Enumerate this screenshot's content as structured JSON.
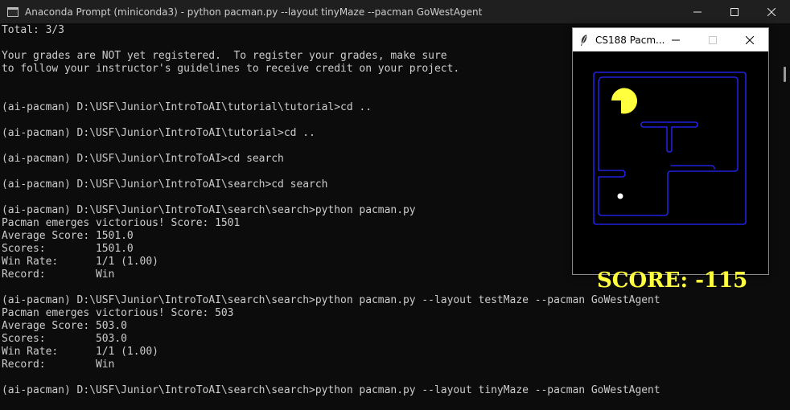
{
  "window": {
    "title": "Anaconda Prompt (miniconda3) - python  pacman.py --layout tinyMaze --pacman GoWestAgent",
    "icon": "terminal-icon",
    "controls": [
      "minimize-icon",
      "maximize-icon",
      "close-icon"
    ]
  },
  "terminal": {
    "lines": [
      "Total: 3/3",
      "",
      "Your grades are NOT yet registered.  To register your grades, make sure",
      "to follow your instructor's guidelines to receive credit on your project.",
      "",
      "",
      "(ai-pacman) D:\\USF\\Junior\\IntroToAI\\tutorial\\tutorial>cd ..",
      "",
      "(ai-pacman) D:\\USF\\Junior\\IntroToAI\\tutorial>cd ..",
      "",
      "(ai-pacman) D:\\USF\\Junior\\IntroToAI>cd search",
      "",
      "(ai-pacman) D:\\USF\\Junior\\IntroToAI\\search>cd search",
      "",
      "(ai-pacman) D:\\USF\\Junior\\IntroToAI\\search\\search>python pacman.py",
      "Pacman emerges victorious! Score: 1501",
      "Average Score: 1501.0",
      "Scores:        1501.0",
      "Win Rate:      1/1 (1.00)",
      "Record:        Win",
      "",
      "(ai-pacman) D:\\USF\\Junior\\IntroToAI\\search\\search>python pacman.py --layout testMaze --pacman GoWestAgent",
      "Pacman emerges victorious! Score: 503",
      "Average Score: 503.0",
      "Scores:        503.0",
      "Win Rate:      1/1 (1.00)",
      "Record:        Win",
      "",
      "(ai-pacman) D:\\USF\\Junior\\IntroToAI\\search\\search>python pacman.py --layout tinyMaze --pacman GoWestAgent"
    ]
  },
  "pacman_window": {
    "title": "CS188 Pacm...",
    "icon": "feather-icon",
    "score_text": "SCORE: -115",
    "colors": {
      "wall": "#2121de",
      "pacman": "#ffff3d",
      "score": "#ffff3d",
      "food": "#ffffff",
      "background": "#000000"
    }
  },
  "colors": {
    "terminal_bg": "#0c0c0c",
    "terminal_text": "#cccccc",
    "titlebar_bg": "#1f1f1f"
  }
}
